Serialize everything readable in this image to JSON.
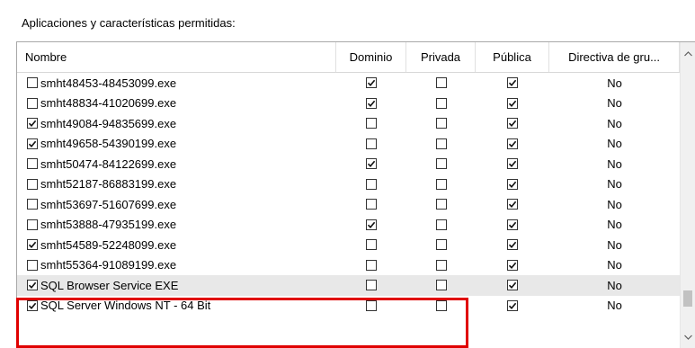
{
  "section_title": "Aplicaciones y características permitidas:",
  "columns": {
    "name": "Nombre",
    "domain": "Dominio",
    "private": "Privada",
    "public": "Pública",
    "policy": "Directiva de gru..."
  },
  "rows": [
    {
      "name": "smht48453-48453099.exe",
      "enabled": false,
      "domain": true,
      "private": false,
      "public": true,
      "policy": "No"
    },
    {
      "name": "smht48834-41020699.exe",
      "enabled": false,
      "domain": true,
      "private": false,
      "public": true,
      "policy": "No"
    },
    {
      "name": "smht49084-94835699.exe",
      "enabled": true,
      "domain": false,
      "private": false,
      "public": true,
      "policy": "No"
    },
    {
      "name": "smht49658-54390199.exe",
      "enabled": true,
      "domain": false,
      "private": false,
      "public": true,
      "policy": "No"
    },
    {
      "name": "smht50474-84122699.exe",
      "enabled": false,
      "domain": true,
      "private": false,
      "public": true,
      "policy": "No"
    },
    {
      "name": "smht52187-86883199.exe",
      "enabled": false,
      "domain": false,
      "private": false,
      "public": true,
      "policy": "No"
    },
    {
      "name": "smht53697-51607699.exe",
      "enabled": false,
      "domain": false,
      "private": false,
      "public": true,
      "policy": "No"
    },
    {
      "name": "smht53888-47935199.exe",
      "enabled": false,
      "domain": true,
      "private": false,
      "public": true,
      "policy": "No"
    },
    {
      "name": "smht54589-52248099.exe",
      "enabled": true,
      "domain": false,
      "private": false,
      "public": true,
      "policy": "No"
    },
    {
      "name": "smht55364-91089199.exe",
      "enabled": false,
      "domain": false,
      "private": false,
      "public": true,
      "policy": "No"
    },
    {
      "name": "SQL Browser Service EXE",
      "enabled": true,
      "domain": false,
      "private": false,
      "public": true,
      "policy": "No",
      "selected": true
    },
    {
      "name": "SQL Server Windows NT - 64 Bit",
      "enabled": true,
      "domain": false,
      "private": false,
      "public": true,
      "policy": "No"
    }
  ],
  "colors": {
    "highlight": "#e00000",
    "selected_row": "#e8e8e8",
    "scrollbar": "#f0f0f0"
  },
  "icons": {
    "check": "checkmark-icon",
    "scroll_up": "chevron-up-icon",
    "scroll_down": "chevron-down-icon"
  }
}
